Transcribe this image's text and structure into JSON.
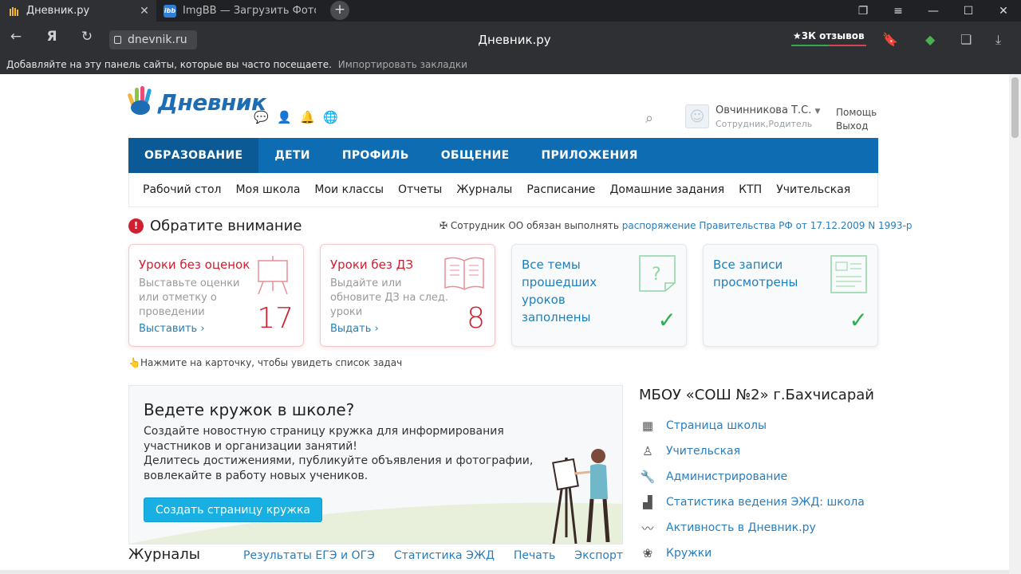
{
  "browser": {
    "tabs": [
      {
        "title": "Дневник.ру",
        "active": true
      },
      {
        "title": "ImgBB — Загрузить Фото",
        "active": false
      }
    ],
    "address": "dnevnik.ru",
    "page_title": "Дневник.ру",
    "reviews": "3К отзывов",
    "bookmarks_hint": "Добавляйте на эту панель сайты, которые вы часто посещаете.",
    "bookmarks_import": "Импортировать закладки"
  },
  "header": {
    "logo": "Дневник",
    "user_name": "Овчинникова Т.С.",
    "user_role": "Сотрудник,Родитель",
    "help": "Помощь",
    "logout": "Выход"
  },
  "main_nav": [
    "ОБРАЗОВАНИЕ",
    "ДЕТИ",
    "ПРОФИЛЬ",
    "ОБЩЕНИЕ",
    "ПРИЛОЖЕНИЯ"
  ],
  "sub_nav": [
    "Рабочий стол",
    "Моя школа",
    "Мои классы",
    "Отчеты",
    "Журналы",
    "Расписание",
    "Домашние задания",
    "КТП",
    "Учительская"
  ],
  "attention": {
    "title": "Обратите внимание",
    "decree_text": "Сотрудник ОО обязан выполнять",
    "decree_link": "распоряжение Правительства РФ от 17.12.2009 N 1993-р"
  },
  "cards": [
    {
      "title": "Уроки без оценок",
      "desc": "Выставьте оценки или отметку о проведении",
      "count": "17",
      "action": "Выставить ›"
    },
    {
      "title": "Уроки без ДЗ",
      "desc": "Выдайте или обновите ДЗ на след. уроки",
      "count": "8",
      "action": "Выдать ›"
    },
    {
      "title": "Все темы прошедших уроков заполнены"
    },
    {
      "title": "Все записи просмотрены"
    }
  ],
  "hint": "Нажмите на карточку, чтобы увидеть список задач",
  "promo": {
    "title": "Ведете кружок в школе?",
    "line1": "Создайте новостную страницу кружка для информирования участников и организации занятий!",
    "line2": "Делитесь достижениями, публикуйте объявления и фотографии, вовлекайте в работу новых учеников.",
    "button": "Создать страницу кружка"
  },
  "journals": {
    "title": "Журналы",
    "links": [
      "Результаты ЕГЭ и ОГЭ",
      "Статистика ЭЖД",
      "Печать",
      "Экспорт"
    ]
  },
  "school": {
    "name": "МБОУ «СОШ №2» г.Бахчисарай",
    "links": [
      {
        "label": "Страница школы",
        "icon": "building-icon"
      },
      {
        "label": "Учительская",
        "icon": "teacher-icon"
      },
      {
        "label": "Администрирование",
        "icon": "wrench-icon"
      },
      {
        "label": "Статистика ведения ЭЖД: школа",
        "icon": "chart-icon"
      },
      {
        "label": "Активность в Дневник.ру",
        "icon": "activity-icon"
      },
      {
        "label": "Кружки",
        "icon": "circles-icon"
      }
    ]
  },
  "colors": {
    "nav_blue": "#0e6cb3",
    "alert_red": "#d0202f",
    "link_blue": "#2a7dbd",
    "check_green": "#2bb24c"
  }
}
